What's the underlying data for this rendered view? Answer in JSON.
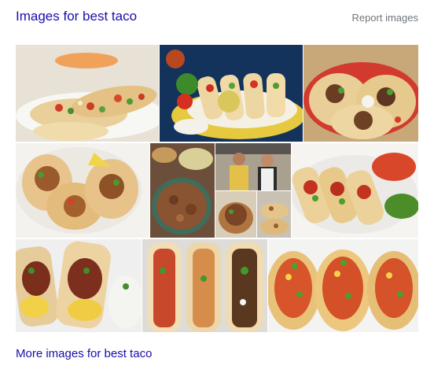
{
  "header": {
    "title": "Images for best taco",
    "report": "Report images"
  },
  "footer": {
    "more_link": "More images for best taco"
  },
  "colors": {
    "link": "#1a0dab",
    "muted": "#70757a"
  }
}
